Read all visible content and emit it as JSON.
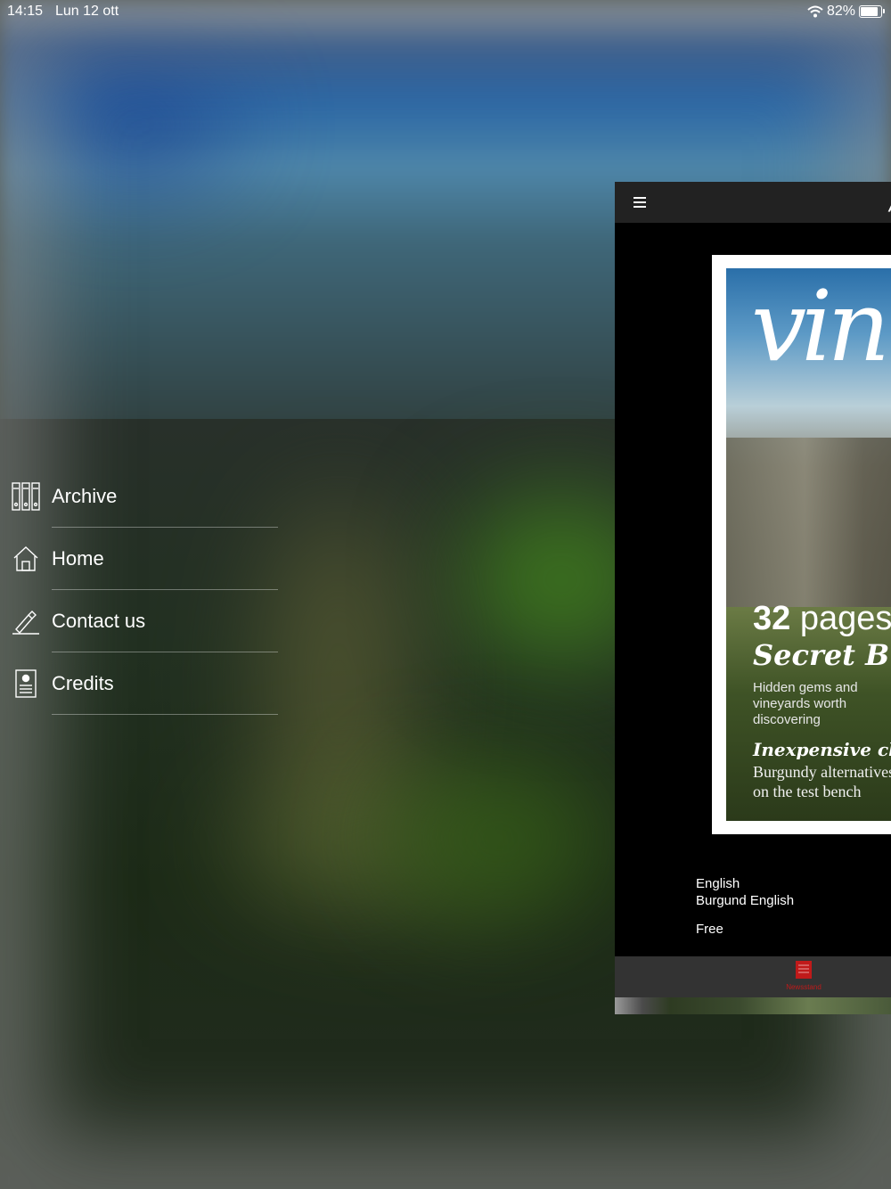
{
  "status_bar": {
    "time": "14:15",
    "date": "Lun 12 ott",
    "battery": "82%",
    "wifi_icon": "wifi-icon",
    "battery_icon": "battery-icon"
  },
  "menu": {
    "items": [
      {
        "label": "Archive",
        "icon": "archive-icon"
      },
      {
        "label": "Home",
        "icon": "home-icon"
      },
      {
        "label": "Contact us",
        "icon": "pen-icon"
      },
      {
        "label": "Credits",
        "icon": "credits-icon"
      }
    ]
  },
  "preview": {
    "menu_icon": "hamburger-menu-icon",
    "cover": {
      "logo": "vin",
      "pages": "32",
      "pages_suffix": " pages",
      "headline": "Secret Burgundy",
      "subhead": "Hidden gems and vineyards worth discovering",
      "headline2": "Inexpensive classics",
      "subhead2_line1": "Burgundy alternatives",
      "subhead2_line2": "on the test bench"
    },
    "language": "English",
    "edition": "Burgund English",
    "price": "Free",
    "tab": {
      "label": "Newsstand",
      "icon": "newsstand-icon",
      "color": "#c01a1a"
    }
  }
}
